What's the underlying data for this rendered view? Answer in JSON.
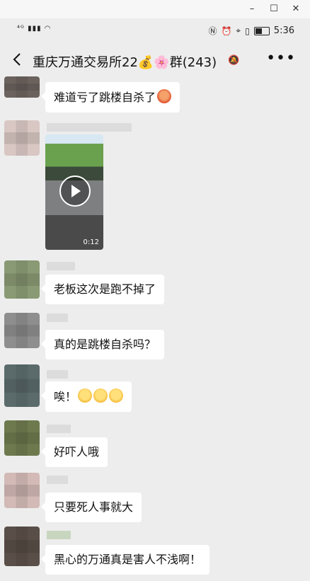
{
  "window": {
    "minimize_icon": "minimize-icon",
    "maximize_icon": "maximize-icon",
    "close_icon": "close-icon"
  },
  "status_bar": {
    "network": "⁴ᴳ",
    "time": "5:36"
  },
  "header": {
    "title": "重庆万通交易所22💰🌸群(243)",
    "back_icon": "chevron-left-icon",
    "mute_icon": "bell-muted-icon",
    "more_label": "•••"
  },
  "messages": [
    {
      "type": "text",
      "text": "难道亏了跳楼自杀了",
      "emoji": "face-emoji"
    },
    {
      "type": "video",
      "duration": "0:12"
    },
    {
      "type": "text",
      "text": "老板这次是跑不掉了"
    },
    {
      "type": "text",
      "text": "真的是跳楼自杀吗？"
    },
    {
      "type": "text",
      "text": "唉！",
      "emoji_count": 3
    },
    {
      "type": "text",
      "text": "好吓人哦"
    },
    {
      "type": "text",
      "text": "只要死人事就大"
    },
    {
      "type": "text",
      "text": "黑心的万通真是害人不浅啊！"
    }
  ],
  "colors": {
    "background": "#ededed",
    "bubble": "#ffffff"
  }
}
